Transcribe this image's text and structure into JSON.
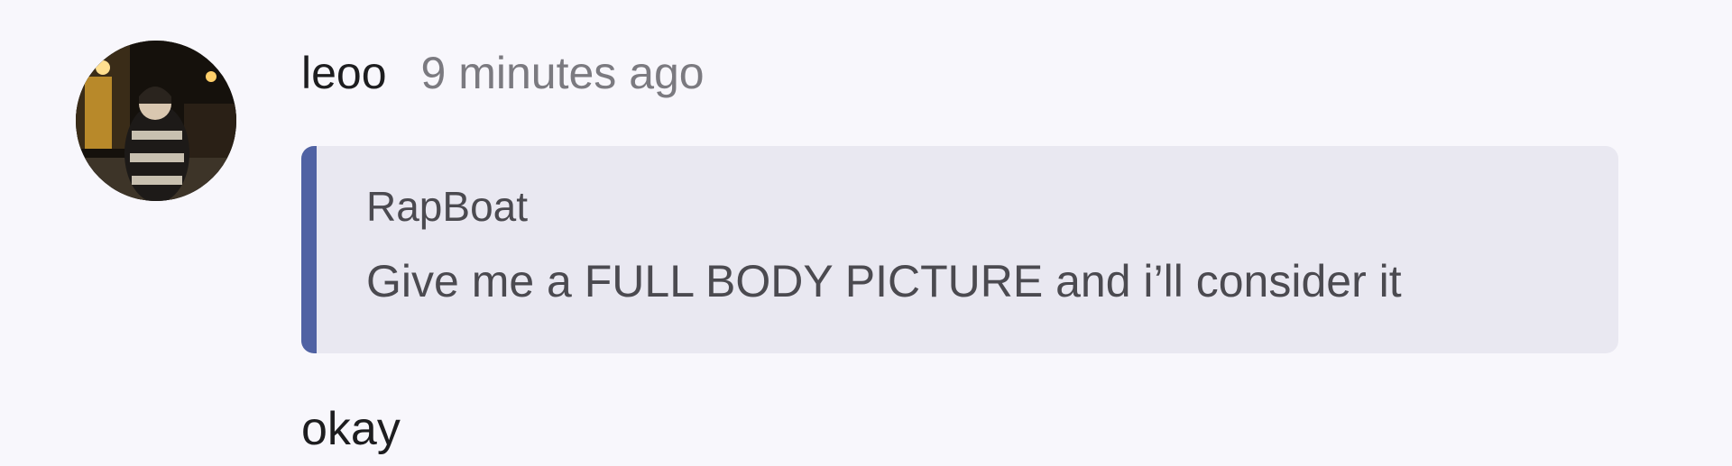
{
  "comment": {
    "author": "leoo",
    "timestamp": "9 minutes ago",
    "quote": {
      "author": "RapBoat",
      "text": "Give me a FULL BODY PICTURE and i’ll consider it",
      "accent_color": "#5062a3"
    },
    "message": "okay"
  }
}
